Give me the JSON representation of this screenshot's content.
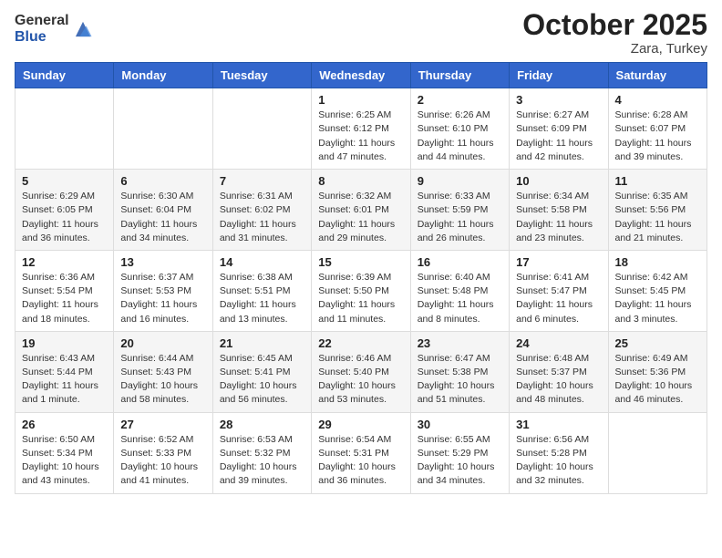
{
  "header": {
    "logo_general": "General",
    "logo_blue": "Blue",
    "month_title": "October 2025",
    "location": "Zara, Turkey"
  },
  "days_of_week": [
    "Sunday",
    "Monday",
    "Tuesday",
    "Wednesday",
    "Thursday",
    "Friday",
    "Saturday"
  ],
  "weeks": [
    [
      {
        "day": "",
        "info": ""
      },
      {
        "day": "",
        "info": ""
      },
      {
        "day": "",
        "info": ""
      },
      {
        "day": "1",
        "info": "Sunrise: 6:25 AM\nSunset: 6:12 PM\nDaylight: 11 hours and 47 minutes."
      },
      {
        "day": "2",
        "info": "Sunrise: 6:26 AM\nSunset: 6:10 PM\nDaylight: 11 hours and 44 minutes."
      },
      {
        "day": "3",
        "info": "Sunrise: 6:27 AM\nSunset: 6:09 PM\nDaylight: 11 hours and 42 minutes."
      },
      {
        "day": "4",
        "info": "Sunrise: 6:28 AM\nSunset: 6:07 PM\nDaylight: 11 hours and 39 minutes."
      }
    ],
    [
      {
        "day": "5",
        "info": "Sunrise: 6:29 AM\nSunset: 6:05 PM\nDaylight: 11 hours and 36 minutes."
      },
      {
        "day": "6",
        "info": "Sunrise: 6:30 AM\nSunset: 6:04 PM\nDaylight: 11 hours and 34 minutes."
      },
      {
        "day": "7",
        "info": "Sunrise: 6:31 AM\nSunset: 6:02 PM\nDaylight: 11 hours and 31 minutes."
      },
      {
        "day": "8",
        "info": "Sunrise: 6:32 AM\nSunset: 6:01 PM\nDaylight: 11 hours and 29 minutes."
      },
      {
        "day": "9",
        "info": "Sunrise: 6:33 AM\nSunset: 5:59 PM\nDaylight: 11 hours and 26 minutes."
      },
      {
        "day": "10",
        "info": "Sunrise: 6:34 AM\nSunset: 5:58 PM\nDaylight: 11 hours and 23 minutes."
      },
      {
        "day": "11",
        "info": "Sunrise: 6:35 AM\nSunset: 5:56 PM\nDaylight: 11 hours and 21 minutes."
      }
    ],
    [
      {
        "day": "12",
        "info": "Sunrise: 6:36 AM\nSunset: 5:54 PM\nDaylight: 11 hours and 18 minutes."
      },
      {
        "day": "13",
        "info": "Sunrise: 6:37 AM\nSunset: 5:53 PM\nDaylight: 11 hours and 16 minutes."
      },
      {
        "day": "14",
        "info": "Sunrise: 6:38 AM\nSunset: 5:51 PM\nDaylight: 11 hours and 13 minutes."
      },
      {
        "day": "15",
        "info": "Sunrise: 6:39 AM\nSunset: 5:50 PM\nDaylight: 11 hours and 11 minutes."
      },
      {
        "day": "16",
        "info": "Sunrise: 6:40 AM\nSunset: 5:48 PM\nDaylight: 11 hours and 8 minutes."
      },
      {
        "day": "17",
        "info": "Sunrise: 6:41 AM\nSunset: 5:47 PM\nDaylight: 11 hours and 6 minutes."
      },
      {
        "day": "18",
        "info": "Sunrise: 6:42 AM\nSunset: 5:45 PM\nDaylight: 11 hours and 3 minutes."
      }
    ],
    [
      {
        "day": "19",
        "info": "Sunrise: 6:43 AM\nSunset: 5:44 PM\nDaylight: 11 hours and 1 minute."
      },
      {
        "day": "20",
        "info": "Sunrise: 6:44 AM\nSunset: 5:43 PM\nDaylight: 10 hours and 58 minutes."
      },
      {
        "day": "21",
        "info": "Sunrise: 6:45 AM\nSunset: 5:41 PM\nDaylight: 10 hours and 56 minutes."
      },
      {
        "day": "22",
        "info": "Sunrise: 6:46 AM\nSunset: 5:40 PM\nDaylight: 10 hours and 53 minutes."
      },
      {
        "day": "23",
        "info": "Sunrise: 6:47 AM\nSunset: 5:38 PM\nDaylight: 10 hours and 51 minutes."
      },
      {
        "day": "24",
        "info": "Sunrise: 6:48 AM\nSunset: 5:37 PM\nDaylight: 10 hours and 48 minutes."
      },
      {
        "day": "25",
        "info": "Sunrise: 6:49 AM\nSunset: 5:36 PM\nDaylight: 10 hours and 46 minutes."
      }
    ],
    [
      {
        "day": "26",
        "info": "Sunrise: 6:50 AM\nSunset: 5:34 PM\nDaylight: 10 hours and 43 minutes."
      },
      {
        "day": "27",
        "info": "Sunrise: 6:52 AM\nSunset: 5:33 PM\nDaylight: 10 hours and 41 minutes."
      },
      {
        "day": "28",
        "info": "Sunrise: 6:53 AM\nSunset: 5:32 PM\nDaylight: 10 hours and 39 minutes."
      },
      {
        "day": "29",
        "info": "Sunrise: 6:54 AM\nSunset: 5:31 PM\nDaylight: 10 hours and 36 minutes."
      },
      {
        "day": "30",
        "info": "Sunrise: 6:55 AM\nSunset: 5:29 PM\nDaylight: 10 hours and 34 minutes."
      },
      {
        "day": "31",
        "info": "Sunrise: 6:56 AM\nSunset: 5:28 PM\nDaylight: 10 hours and 32 minutes."
      },
      {
        "day": "",
        "info": ""
      }
    ]
  ]
}
